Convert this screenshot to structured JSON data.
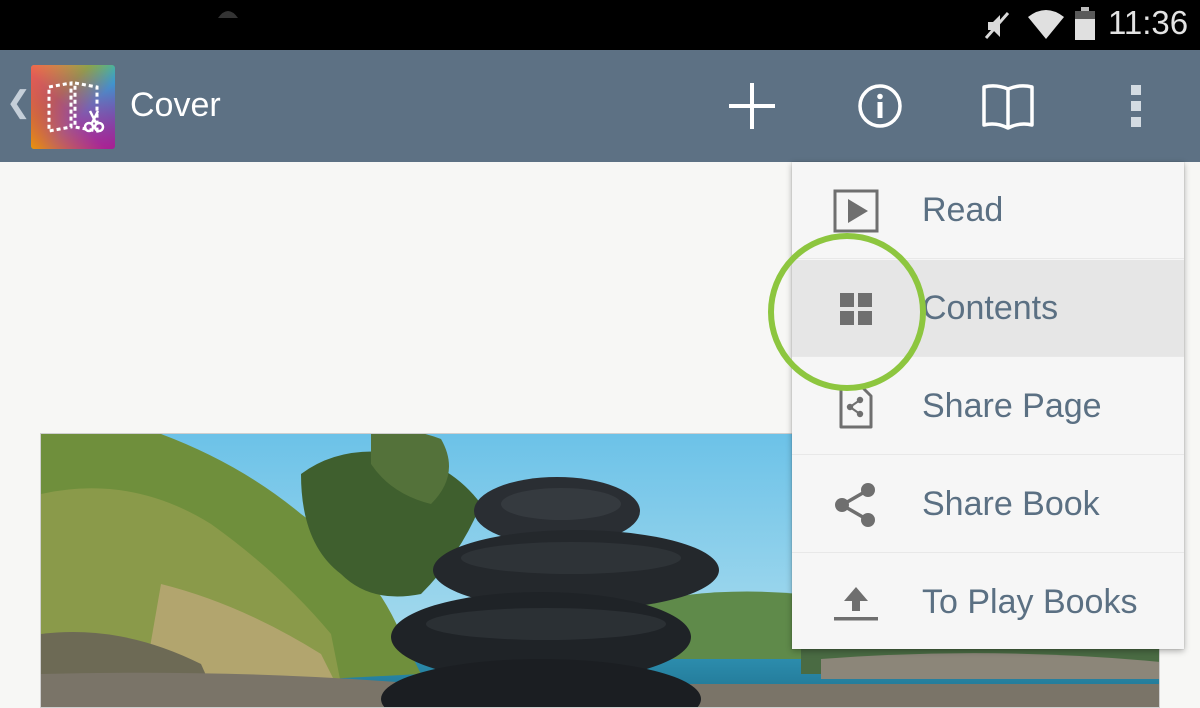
{
  "status_bar": {
    "time": "11:36",
    "icons": [
      "mute-icon",
      "wifi-icon",
      "battery-icon"
    ]
  },
  "action_bar": {
    "title": "Cover",
    "back_icon": "chevron-left-icon",
    "app_icon": "book-creator-logo",
    "actions": [
      {
        "name": "add-icon"
      },
      {
        "name": "info-icon"
      },
      {
        "name": "book-icon"
      },
      {
        "name": "more-vert-icon"
      }
    ],
    "background_color": "#5d7184"
  },
  "menu": {
    "items": [
      {
        "label": "Read",
        "icon": "play-icon",
        "highlighted": false
      },
      {
        "label": "Contents",
        "icon": "grid-icon",
        "highlighted": true
      },
      {
        "label": "Share Page",
        "icon": "share-page-icon",
        "highlighted": false
      },
      {
        "label": "Share Book",
        "icon": "share-icon",
        "highlighted": false
      },
      {
        "label": "To Play Books",
        "icon": "upload-icon",
        "highlighted": false
      }
    ],
    "label_color": "#5b7083"
  },
  "annotation": {
    "ring_color": "#8dc63f"
  },
  "page": {
    "photo": "stacked-stones-photo"
  }
}
